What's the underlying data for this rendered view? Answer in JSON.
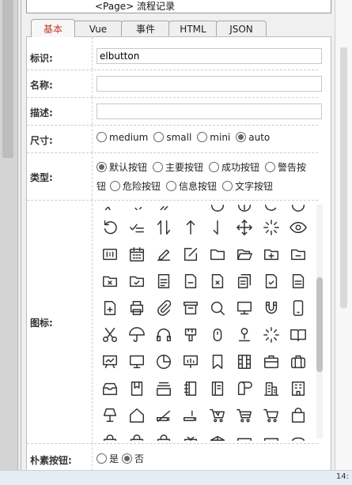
{
  "breadcrumb": {
    "text": "<Page> 流程记录"
  },
  "tabs": [
    {
      "label": "基本"
    },
    {
      "label": "Vue"
    },
    {
      "label": "事件"
    },
    {
      "label": "HTML"
    },
    {
      "label": "JSON"
    }
  ],
  "form": {
    "identifier": {
      "label": "标识:",
      "value": "elbutton"
    },
    "name": {
      "label": "名称:",
      "value": ""
    },
    "description": {
      "label": "描述:",
      "value": ""
    },
    "size": {
      "label": "尺寸:",
      "options": [
        "medium",
        "small",
        "mini",
        "auto"
      ],
      "selected": "auto"
    },
    "type": {
      "label": "类型:",
      "options": [
        "默认按钮",
        "主要按钮",
        "成功按钮",
        "警告按钮",
        "危险按钮",
        "信息按钮",
        "文字按钮"
      ],
      "selected": "默认按钮",
      "wrap_prefix": "警告按",
      "wrap_suffix": "钮"
    },
    "icon": {
      "label": "图标:"
    },
    "plain": {
      "label": "朴素按钮:",
      "options": [
        "是",
        "否"
      ],
      "selected": "否"
    }
  },
  "taskbar": {
    "clock": "14:"
  },
  "colors": {
    "active_tab": "#c0392b",
    "border": "#bdbdbd"
  }
}
